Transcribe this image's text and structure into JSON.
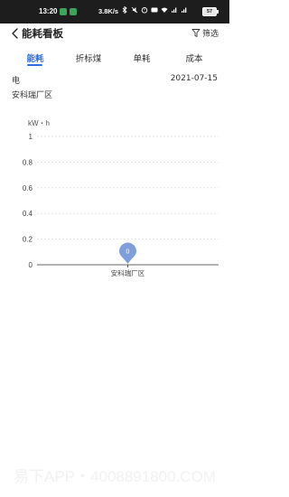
{
  "status_bar": {
    "time": "13:20",
    "speed": "3.8K/s",
    "battery": "57"
  },
  "header": {
    "title": "能耗看板",
    "filter_label": "筛选"
  },
  "tabs": [
    {
      "label": "能耗",
      "active": true
    },
    {
      "label": "折标煤",
      "active": false
    },
    {
      "label": "单耗",
      "active": false
    },
    {
      "label": "成本",
      "active": false
    }
  ],
  "info": {
    "energy_type": "电",
    "date": "2021-07-15",
    "site": "安科瑞厂区"
  },
  "chart_data": {
    "type": "bar",
    "unit": "kW・h",
    "categories": [
      "安科瑞厂区"
    ],
    "values": [
      0
    ],
    "ylim": [
      0,
      1
    ],
    "yticks": [
      "0",
      "0.2",
      "0.4",
      "0.6",
      "0.8",
      "1"
    ],
    "marker_label": "0",
    "marker_color": "#7f9fdc",
    "grid": true
  },
  "watermark": "易下APP・4008891800.COM",
  "colors": {
    "accent": "#2f6fe0",
    "status_bar": "#1d1d1d"
  }
}
